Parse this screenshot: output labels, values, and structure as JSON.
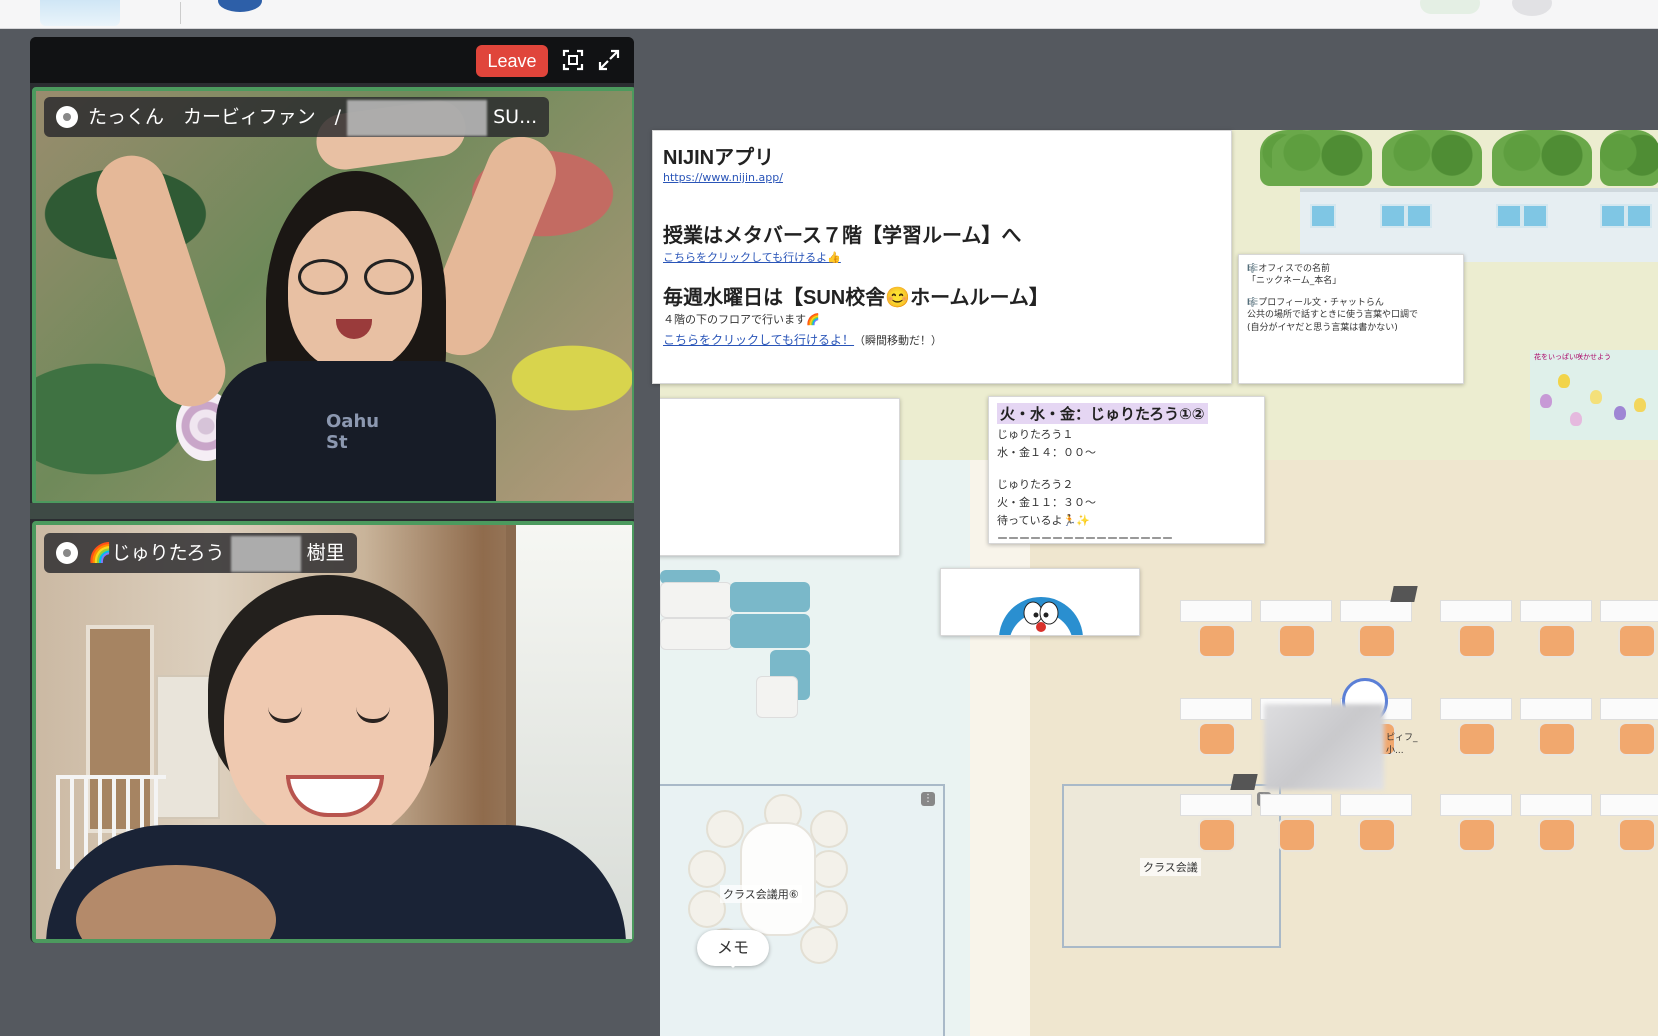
{
  "video": {
    "leave_label": "Leave",
    "participants": [
      {
        "name_part1": "たっくん　カービィファン　/",
        "name_part2": "SU..."
      },
      {
        "name_part1": "🌈じゅりたろう",
        "name_part2": "樹里"
      }
    ],
    "shirt_text": "Oahu St"
  },
  "map": {
    "info_card": {
      "title": "NIJINアプリ",
      "url": "https://www.nijin.app/",
      "heading1": "授業はメタバース７階【学習ルーム】へ",
      "link1": "こちらをクリックしても行けるよ👍",
      "heading2": "毎週水曜日は【SUN校舎😊ホームルーム】",
      "line1": "４階の下のフロアで行います🌈",
      "link2": "こちらをクリックしても行けるよ！",
      "line2_suffix": "（瞬間移動だ！）"
    },
    "rules_card": {
      "line1": "🎼オフィスでの名前",
      "line2": "「ニックネーム_本名」",
      "line3": "🎼プロフィール文・チャットらん",
      "line4": "公共の場所で話すときに使う言葉や口調で",
      "line5": "(自分がイヤだと思う言葉は書かない)"
    },
    "schedule_card": {
      "title": "火・水・金：じゅりたろう①②",
      "lines": [
        "じゅりたろう１",
        "水・金１４：００〜",
        "",
        "じゅりたろう２",
        "火・金１１：３０〜",
        "待っているよ🏃✨",
        "ーーーーーーーーーーーーーーーー"
      ]
    },
    "flower_label": "花をいっぱい咲かせよう",
    "room_labels": {
      "class_meeting_room": "クラス会議用⑥",
      "class_meeting": "クラス会議"
    },
    "avatar_label": "ピィフ_小..."
  },
  "memo_label": "メモ",
  "colors": {
    "leave": "#e0453b",
    "tile_border": "#4c9a5e",
    "link": "#2a55b8",
    "schedule_highlight": "#e5d6f3"
  }
}
